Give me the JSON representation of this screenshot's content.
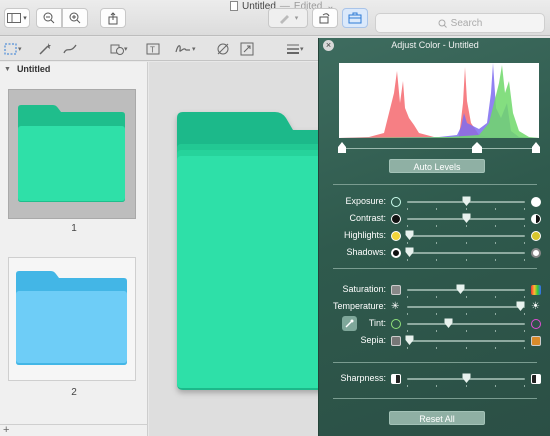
{
  "window": {
    "title": "Untitled",
    "separator": "—",
    "edited": "Edited",
    "edited_chevron": "⌄"
  },
  "search": {
    "placeholder": "Search"
  },
  "sidebar": {
    "heading": "Untitled",
    "pages": [
      {
        "label": "1"
      },
      {
        "label": "2"
      }
    ],
    "add_label": "+"
  },
  "panel": {
    "title": "Adjust Color - Untitled",
    "auto_levels": "Auto Levels",
    "reset_all": "Reset All",
    "rows": [
      {
        "label": "Exposure:",
        "value": 0.5
      },
      {
        "label": "Contrast:",
        "value": 0.5
      },
      {
        "label": "Highlights:",
        "value": 0.02
      },
      {
        "label": "Shadows:",
        "value": 0.02
      },
      {
        "label": "Saturation:",
        "value": 0.45
      },
      {
        "label": "Temperature:",
        "value": 0.96
      },
      {
        "label": "Tint:",
        "value": 0.35
      },
      {
        "label": "Sepia:",
        "value": 0.02
      },
      {
        "label": "Sharpness:",
        "value": 0.5
      }
    ]
  },
  "colors": {
    "folder_green": "#2fe0a8",
    "folder_blue": "#5ac8f5",
    "panel_bg": "#325c50"
  }
}
